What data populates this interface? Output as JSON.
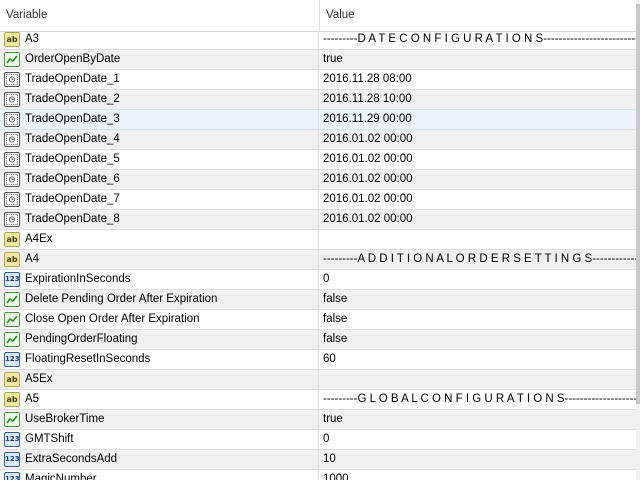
{
  "header": {
    "variable_label": "Variable",
    "value_label": "Value"
  },
  "rows": [
    {
      "icon": "string-icon",
      "icon_text": "ab",
      "name": "A3",
      "value": "---------D A T E  C O N F I G U R A T I O N S---------------------------"
    },
    {
      "icon": "bool-icon",
      "icon_text": "",
      "name": "OrderOpenByDate",
      "value": "true"
    },
    {
      "icon": "datetime-icon",
      "icon_text": "",
      "name": "TradeOpenDate_1",
      "value": "2016.11.28 08:00"
    },
    {
      "icon": "datetime-icon",
      "icon_text": "",
      "name": "TradeOpenDate_2",
      "value": "2016.11.28 10:00"
    },
    {
      "icon": "datetime-icon",
      "icon_text": "",
      "name": "TradeOpenDate_3",
      "value": "2016.11.29 00:00"
    },
    {
      "icon": "datetime-icon",
      "icon_text": "",
      "name": "TradeOpenDate_4",
      "value": "2016.01.02 00:00"
    },
    {
      "icon": "datetime-icon",
      "icon_text": "",
      "name": "TradeOpenDate_5",
      "value": "2016.01.02 00:00"
    },
    {
      "icon": "datetime-icon",
      "icon_text": "",
      "name": "TradeOpenDate_6",
      "value": "2016.01.02 00:00"
    },
    {
      "icon": "datetime-icon",
      "icon_text": "",
      "name": "TradeOpenDate_7",
      "value": "2016.01.02 00:00"
    },
    {
      "icon": "datetime-icon",
      "icon_text": "",
      "name": "TradeOpenDate_8",
      "value": "2016.01.02 00:00"
    },
    {
      "icon": "string-icon",
      "icon_text": "ab",
      "name": "A4Ex",
      "value": ""
    },
    {
      "icon": "string-icon",
      "icon_text": "ab",
      "name": "A4",
      "value": "---------A D D I T I O N A L  O R D E R  S E T T I N G S---------------"
    },
    {
      "icon": "integer-icon",
      "icon_text": "123",
      "name": "ExpirationInSeconds",
      "value": "0"
    },
    {
      "icon": "bool-icon",
      "icon_text": "",
      "name": "Delete Pending Order After Expiration",
      "value": "false"
    },
    {
      "icon": "bool-icon",
      "icon_text": "",
      "name": "Close Open Order After Expiration",
      "value": "false"
    },
    {
      "icon": "bool-icon",
      "icon_text": "",
      "name": "PendingOrderFloating",
      "value": "false"
    },
    {
      "icon": "integer-icon",
      "icon_text": "123",
      "name": "FloatingResetInSeconds",
      "value": "60"
    },
    {
      "icon": "string-icon",
      "icon_text": "ab",
      "name": "A5Ex",
      "value": ""
    },
    {
      "icon": "string-icon",
      "icon_text": "ab",
      "name": "A5",
      "value": "---------G L O B A L  C O N F I G U R A T I O N S-------------------------"
    },
    {
      "icon": "bool-icon",
      "icon_text": "",
      "name": "UseBrokerTime",
      "value": "true"
    },
    {
      "icon": "integer-icon",
      "icon_text": "123",
      "name": "GMTShift",
      "value": "0"
    },
    {
      "icon": "integer-icon",
      "icon_text": "123",
      "name": "ExtraSecondsAdd",
      "value": "10"
    },
    {
      "icon": "integer-icon",
      "icon_text": "123",
      "name": "MagicNumber",
      "value": "1000"
    }
  ],
  "selected_row": 4,
  "colors": {
    "row_alt": "#f0f0f0",
    "row_selected": "#eaf2fb",
    "grid_line": "#dedede"
  }
}
